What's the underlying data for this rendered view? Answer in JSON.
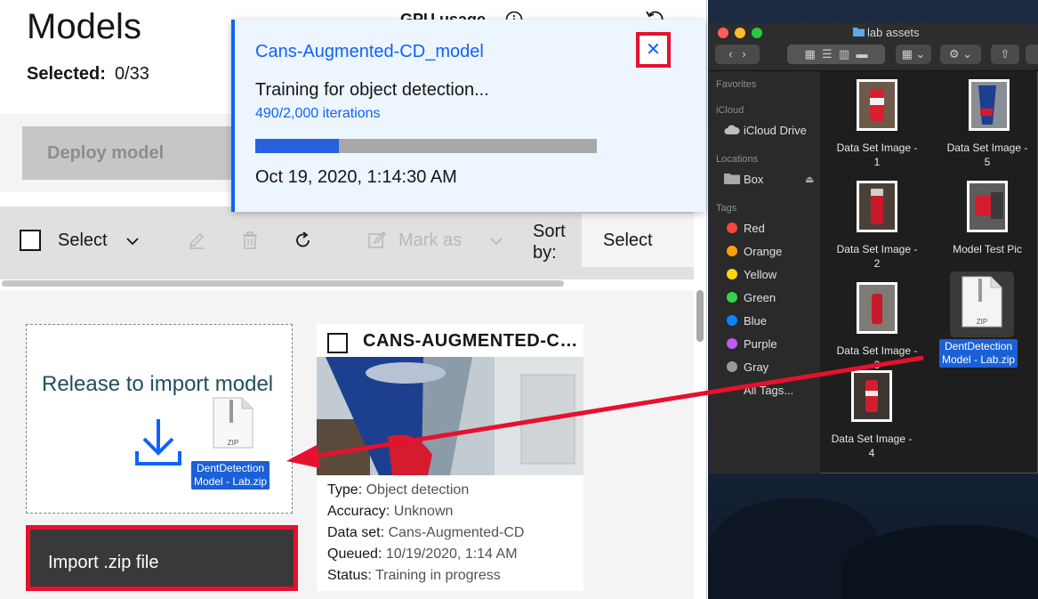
{
  "header": {
    "title": "Models",
    "selected_label": "Selected:",
    "selected_value": "0/33",
    "gpu_label": "GPU usage"
  },
  "actions": {
    "deploy_label": "Deploy model"
  },
  "toolbar": {
    "select_label": "Select",
    "mark_as_label": "Mark as",
    "sort_by_label": "Sort by:",
    "sort_value": "Select"
  },
  "dropzone": {
    "title": "Release to import model",
    "zip_icon_text": "ZIP",
    "file_label_line1": "DentDetection",
    "file_label_line2": "Model - Lab.zip"
  },
  "import_button": {
    "label": "Import .zip file"
  },
  "card": {
    "title": "CANS-AUGMENTED-CD_model",
    "rows": [
      {
        "label": "Type:",
        "value": "Object detection"
      },
      {
        "label": "Accuracy:",
        "value": "Unknown"
      },
      {
        "label": "Data set:",
        "value": "Cans-Augmented-CD"
      },
      {
        "label": "Queued:",
        "value": "10/19/2020, 1:14 AM"
      },
      {
        "label": "Status:",
        "value": "Training in progress"
      }
    ]
  },
  "notification": {
    "title": "Cans-Augmented-CD_model",
    "subtitle": "Training for object detection...",
    "iterations": "490/2,000 iterations",
    "progress_fraction": 0.245,
    "date": "Oct 19, 2020, 1:14:30 AM",
    "close_symbol": "✕"
  },
  "finder": {
    "title": "lab assets",
    "sidebar": {
      "favorites": "Favorites",
      "icloud": "iCloud",
      "icloud_drive": "iCloud Drive",
      "locations": "Locations",
      "box": "Box",
      "tags": "Tags",
      "tag_items": [
        {
          "label": "Red",
          "color": "#ff453a"
        },
        {
          "label": "Orange",
          "color": "#ff9f0a"
        },
        {
          "label": "Yellow",
          "color": "#ffd60a"
        },
        {
          "label": "Green",
          "color": "#32d74b"
        },
        {
          "label": "Blue",
          "color": "#0a84ff"
        },
        {
          "label": "Purple",
          "color": "#bf5af2"
        },
        {
          "label": "Gray",
          "color": "#98989d"
        }
      ],
      "all_tags": "All Tags..."
    },
    "files": [
      {
        "line1": "Data Set Image -",
        "line2": "1"
      },
      {
        "line1": "Data Set Image -",
        "line2": "5"
      },
      {
        "line1": "Data Set Image -",
        "line2": "2"
      },
      {
        "line1": "Model Test Pic",
        "line2": ""
      },
      {
        "line1": "Data Set Image -",
        "line2": "3"
      },
      {
        "line1": "Data Set Image -",
        "line2": "4"
      }
    ],
    "zip_icon_text": "ZIP",
    "zip_label_line1": "DentDetection",
    "zip_label_line2": "Model - Lab.zip"
  },
  "colors": {
    "accent": "#0f62fe",
    "highlight": "#e8102f",
    "notification_bg": "#edf5ff"
  }
}
